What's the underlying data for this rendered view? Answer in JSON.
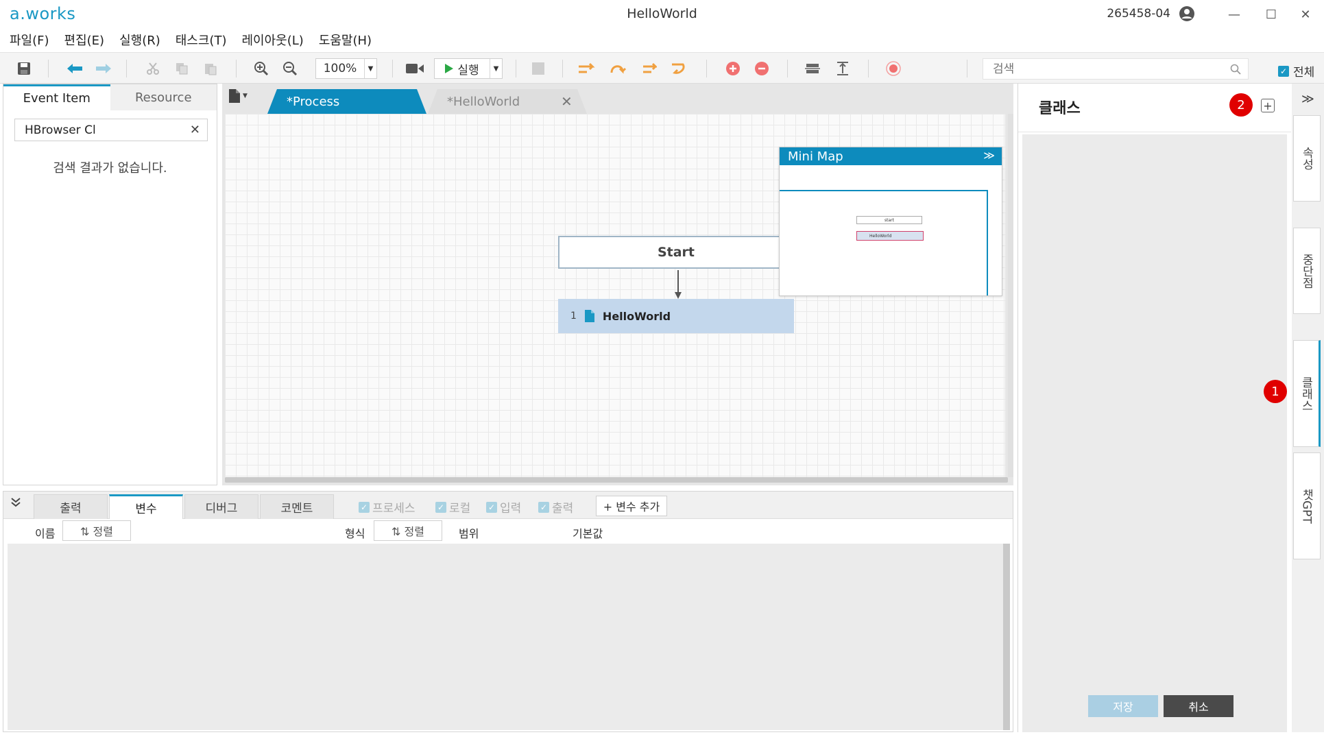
{
  "app": {
    "logo": "a.works",
    "title": "HelloWorld",
    "user_id": "265458-04"
  },
  "window_controls": {
    "minimize": "—",
    "maximize": "☐",
    "close": "✕"
  },
  "menu": [
    "파일(F)",
    "편집(E)",
    "실행(R)",
    "태스크(T)",
    "레이아웃(L)",
    "도움말(H)"
  ],
  "toolbar": {
    "zoom": "100%",
    "run_label": "실행",
    "search_placeholder": "검색",
    "all_label": "전체",
    "all_checked": true
  },
  "left_panel": {
    "tabs": [
      "Event Item",
      "Resource"
    ],
    "active_tab": "Event Item",
    "search_value": "HBrowser Cl",
    "no_result": "검색 결과가 없습니다."
  },
  "editor": {
    "tabs": [
      {
        "label": "*Process",
        "active": true
      },
      {
        "label": "*HelloWorld",
        "active": false
      }
    ],
    "nodes": {
      "start": "Start",
      "step_number": "1",
      "step_label": "HelloWorld"
    },
    "minimap": {
      "title": "Mini Map",
      "start": "start",
      "step": "HelloWorld"
    }
  },
  "bottom_panel": {
    "tabs": [
      "출력",
      "변수",
      "디버그",
      "코멘트"
    ],
    "active_tab": "변수",
    "filters": [
      "프로세스",
      "로컬",
      "입력",
      "출력"
    ],
    "add_variable": "+ 변수 추가",
    "columns": {
      "name": "이름",
      "sort": "⇅ 정렬",
      "type": "형식",
      "scope": "범위",
      "default": "기본값"
    }
  },
  "right_panel": {
    "title": "클래스",
    "save": "저장",
    "cancel": "취소",
    "badges": [
      "1",
      "2"
    ]
  },
  "side_tabs": [
    "속성",
    "중단점",
    "클래스",
    "챗GPT"
  ],
  "active_side_tab": "클래스",
  "colors": {
    "accent": "#1a98c4",
    "tab_active": "#0d8bbd",
    "badge": "#e00000"
  }
}
